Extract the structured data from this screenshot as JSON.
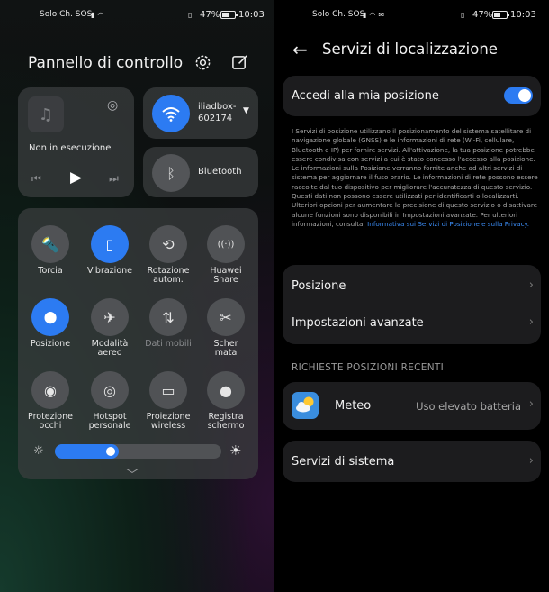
{
  "left_status": {
    "carrier": "Solo Ch. SOS",
    "battery": "47%",
    "time": "10:03"
  },
  "right_status": {
    "carrier": "Solo Ch. SOS",
    "battery": "47%",
    "time": "10:03"
  },
  "control_center": {
    "title": "Pannello di controllo",
    "media": {
      "status": "Non in esecuzione"
    },
    "wifi": {
      "label": "iliadbox-\n602174"
    },
    "bluetooth": {
      "label": "Bluetooth"
    },
    "tiles": [
      {
        "label": "Torcia",
        "on": false,
        "icon": "flashlight-icon"
      },
      {
        "label": "Vibrazione",
        "on": true,
        "icon": "vibration-icon"
      },
      {
        "label": "Rotazione\nautom.",
        "on": false,
        "icon": "rotation-icon"
      },
      {
        "label": "Huawei\nShare",
        "on": false,
        "icon": "share-icon"
      },
      {
        "label": "Posizione",
        "on": true,
        "icon": "location-icon"
      },
      {
        "label": "Modalità\naereo",
        "on": false,
        "icon": "airplane-icon"
      },
      {
        "label": "Dati mobili",
        "on": false,
        "icon": "mobile-data-icon",
        "dim": true
      },
      {
        "label": "Scher\nmata",
        "on": false,
        "icon": "screenshot-icon"
      },
      {
        "label": "Protezione\nocchi",
        "on": false,
        "icon": "eye-icon"
      },
      {
        "label": "Hotspot\npersonale",
        "on": false,
        "icon": "hotspot-icon"
      },
      {
        "label": "Proiezione\nwireless",
        "on": false,
        "icon": "projection-icon"
      },
      {
        "label": "Registra\nschermo",
        "on": false,
        "icon": "record-icon"
      }
    ],
    "brightness": 0.34
  },
  "location": {
    "title": "Servizi di localizzazione",
    "access_label": "Accedi alla mia posizione",
    "access_on": true,
    "description": "I Servizi di posizione utilizzano il posizionamento del sistema satellitare di navigazione globale (GNSS) e le informazioni di rete (Wi-Fi, cellulare, Bluetooth e IP) per fornire servizi. All'attivazione, la tua posizione potrebbe essere condivisa con servizi a cui è stato concesso l'accesso alla posizione. Le informazioni sulla Posizione verranno fornite anche ad altri servizi di sistema per aggiornare il fuso orario. Le informazioni di rete possono essere raccolte dal tuo dispositivo per migliorare l'accuratezza di questo servizio. Questi dati non possono essere utilizzati per identificarti o localizzarti. Ulteriori opzioni per aumentare la precisione di questo servizio o disattivare alcune funzioni sono disponibili in Impostazioni avanzate. Per ulteriori informazioni, consulta:",
    "link": "Informativa sui Servizi di Posizione e sulla Privacy.",
    "items": [
      "Posizione",
      "Impostazioni avanzate"
    ],
    "section": "RICHIESTE POSIZIONI RECENTI",
    "recent": {
      "name": "Meteo",
      "value": "Uso elevato batteria"
    },
    "system": "Servizi di sistema"
  }
}
